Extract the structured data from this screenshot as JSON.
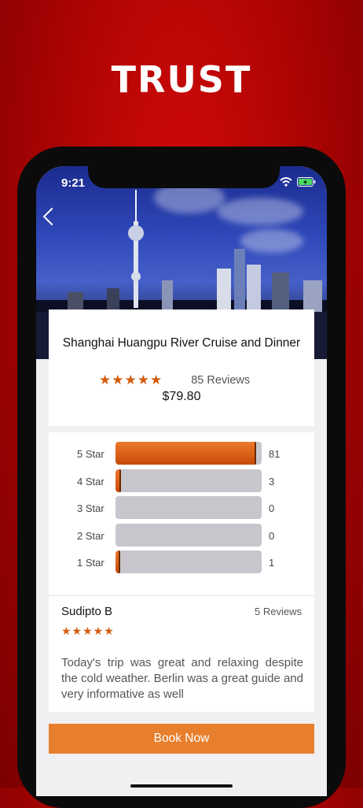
{
  "headline": "TRUST",
  "status_bar": {
    "time": "9:21"
  },
  "tour": {
    "title": "Shanghai Huangpu River Cruise and Dinner",
    "stars": "★★★★★",
    "reviews": "85 Reviews",
    "price": "$79.80"
  },
  "rating_breakdown": [
    {
      "label": "5 Star",
      "count": "81",
      "fraction": 0.96
    },
    {
      "label": "4 Star",
      "count": "3",
      "fraction": 0.035
    },
    {
      "label": "3 Star",
      "count": "0",
      "fraction": 0
    },
    {
      "label": "2 Star",
      "count": "0",
      "fraction": 0
    },
    {
      "label": "1 Star",
      "count": "1",
      "fraction": 0.012
    }
  ],
  "review": {
    "author": "Sudipto B",
    "author_reviews": "5 Reviews",
    "stars": "★★★★★",
    "text": "Today's trip was great and relaxing despite the cold weather. Berlin was a great guide and very informative as well"
  },
  "book_button": "Book Now",
  "colors": {
    "accent": "#e87f2d",
    "star": "#d35b0c",
    "background": "#b00404"
  }
}
